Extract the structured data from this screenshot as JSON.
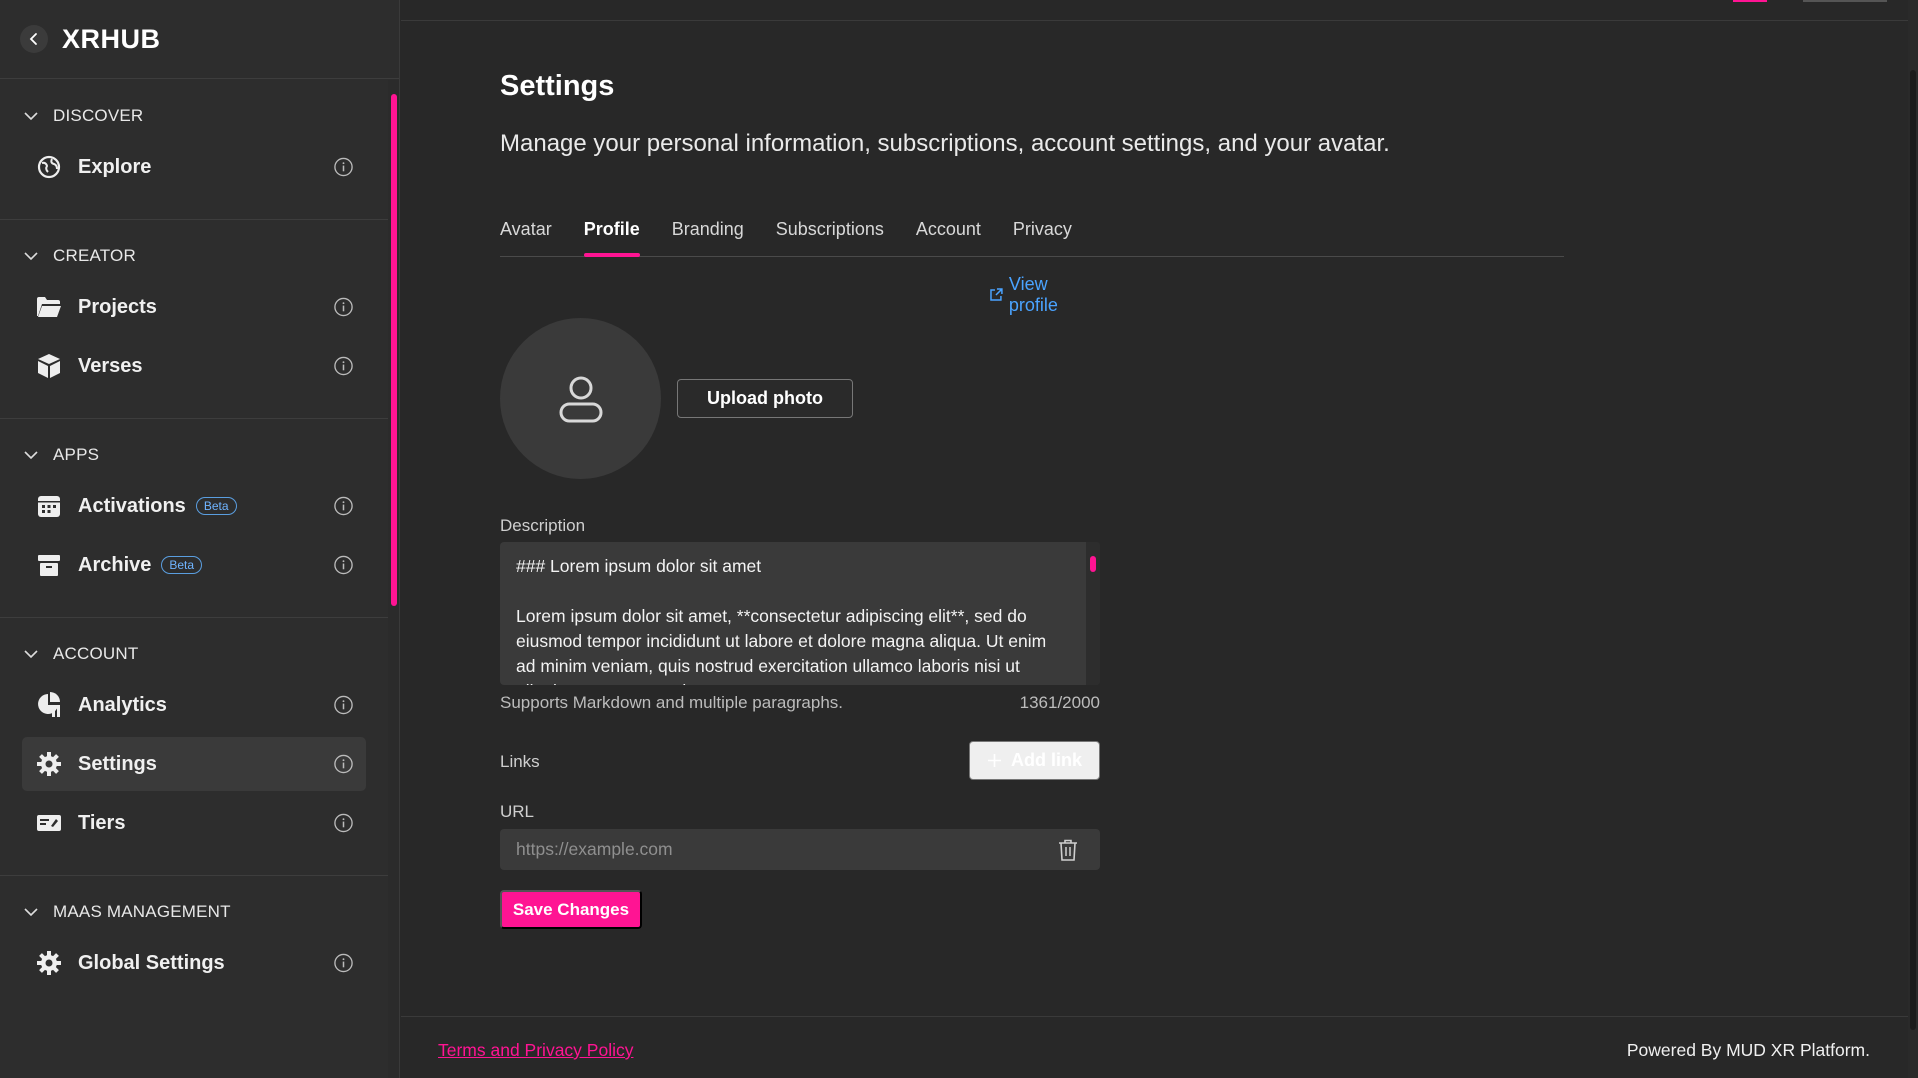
{
  "sidebar": {
    "brand": "XRHUB",
    "sections": [
      {
        "title": "DISCOVER",
        "items": [
          {
            "label": "Explore"
          }
        ]
      },
      {
        "title": "CREATOR",
        "items": [
          {
            "label": "Projects"
          },
          {
            "label": "Verses"
          }
        ]
      },
      {
        "title": "APPS",
        "items": [
          {
            "label": "Activations",
            "badge": "Beta"
          },
          {
            "label": "Archive",
            "badge": "Beta"
          }
        ]
      },
      {
        "title": "ACCOUNT",
        "items": [
          {
            "label": "Analytics"
          },
          {
            "label": "Settings"
          },
          {
            "label": "Tiers"
          }
        ]
      },
      {
        "title": "MAAS MANAGEMENT",
        "items": [
          {
            "label": "Global Settings"
          }
        ]
      }
    ]
  },
  "main": {
    "title": "Settings",
    "subtitle": "Manage your personal information, subscriptions, account settings, and your avatar.",
    "tabs": [
      {
        "label": "Avatar"
      },
      {
        "label": "Profile"
      },
      {
        "label": "Branding"
      },
      {
        "label": "Subscriptions"
      },
      {
        "label": "Account"
      },
      {
        "label": "Privacy"
      }
    ],
    "active_tab": "Profile",
    "view_profile": "View profile",
    "upload_photo": "Upload photo",
    "description_label": "Description",
    "description_value": "### Lorem ipsum dolor sit amet\n\nLorem ipsum dolor sit amet, **consectetur adipiscing elit**, sed do eiusmod tempor incididunt ut labore et dolore magna aliqua. Ut enim ad minim veniam, quis nostrud exercitation ullamco laboris nisi ut aliquip ex ea commodo consequat.",
    "description_hint": "Supports Markdown and multiple paragraphs.",
    "description_count": "1361/2000",
    "links_label": "Links",
    "add_link": "Add link",
    "url_label": "URL",
    "url_placeholder": "https://example.com",
    "save_button": "Save Changes"
  },
  "footer": {
    "terms": "Terms and Privacy Policy",
    "powered": "Powered By MUD XR Platform."
  },
  "colors": {
    "accent": "#ff1493",
    "link": "#4aa3ff",
    "background": "#282828",
    "sidebar": "#2d2d2d"
  }
}
